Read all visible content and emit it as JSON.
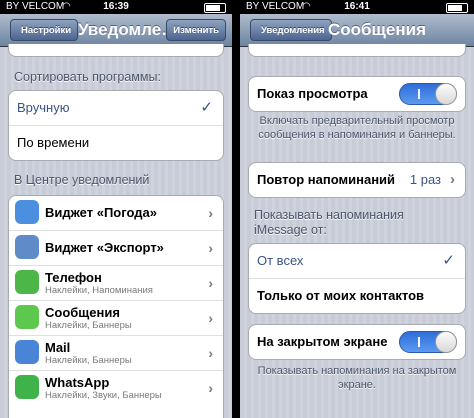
{
  "left": {
    "status": {
      "carrier": "BY VELCOM",
      "time": "16:39"
    },
    "nav": {
      "back_label": "Настройки",
      "title": "Уведомле…",
      "edit_label": "Изменить"
    },
    "sort_label": "Сортировать программы:",
    "sort_options": [
      "Вручную",
      "По времени"
    ],
    "center_label": "В Центре уведомлений",
    "apps": [
      {
        "name": "Виджет «Погода»",
        "sub": "",
        "icon_color": "#4a8fe0"
      },
      {
        "name": "Виджет «Экспорт»",
        "sub": "",
        "icon_color": "#5f8cc9"
      },
      {
        "name": "Телефон",
        "sub": "Наклейки, Напоминания",
        "icon_color": "#4cb648"
      },
      {
        "name": "Сообщения",
        "sub": "Наклейки, Баннеры",
        "icon_color": "#5dc84e"
      },
      {
        "name": "Mail",
        "sub": "Наклейки, Баннеры",
        "icon_color": "#4a84d6"
      },
      {
        "name": "WhatsApp",
        "sub": "Наклейки, Звуки, Баннеры",
        "icon_color": "#3fb34a"
      }
    ]
  },
  "right": {
    "status": {
      "carrier": "BY VELCOM",
      "time": "16:41"
    },
    "nav": {
      "back_label": "Уведомления",
      "title": "Сообщения"
    },
    "preview_label": "Показ просмотра",
    "preview_note": "Включать предварительный просмотр сообщения в напоминания и баннеры.",
    "repeat_label": "Повтор напоминаний",
    "repeat_value": "1 раз",
    "imessage_label": "Показывать напоминания iMessage от:",
    "from_options": [
      "От всех",
      "Только от моих контактов"
    ],
    "lock_label": "На закрытом экране",
    "lock_note": "Показывать напоминания на закрытом экране."
  }
}
